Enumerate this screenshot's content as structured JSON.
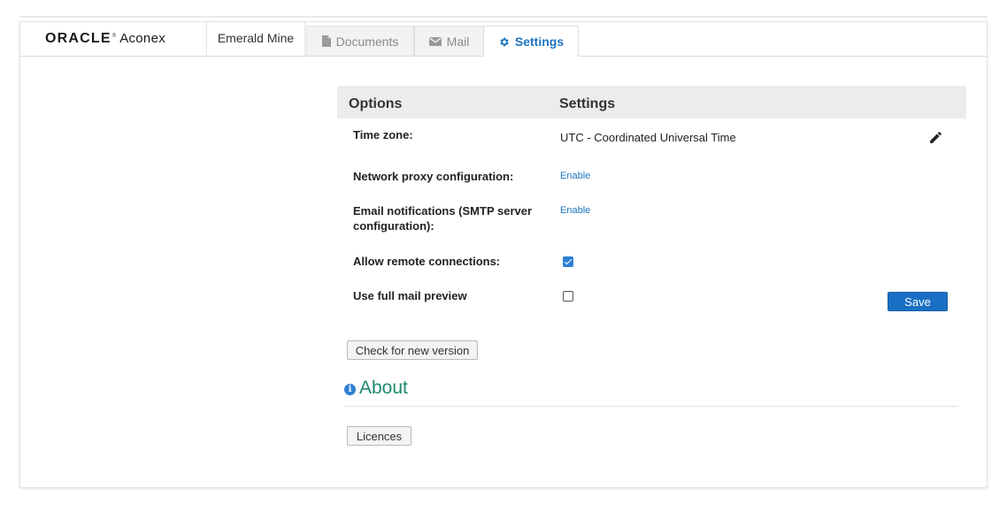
{
  "brand": {
    "oracle": "ORACLE",
    "reg": "®",
    "product": "Aconex"
  },
  "project": {
    "name": "Emerald Mine"
  },
  "tabs": [
    {
      "label": "Documents",
      "icon": "document-icon",
      "active": false
    },
    {
      "label": "Mail",
      "icon": "envelope-icon",
      "active": false
    },
    {
      "label": "Settings",
      "icon": "gear-icon",
      "active": true
    }
  ],
  "panel": {
    "col_options": "Options",
    "col_settings": "Settings"
  },
  "rows": {
    "timezone": {
      "label": "Time zone:",
      "value": "UTC - Coordinated Universal Time",
      "icon": "pencil-icon"
    },
    "proxy": {
      "label": "Network proxy configuration:",
      "link": "Enable"
    },
    "smtp": {
      "label": "Email notifications (SMTP server configuration):",
      "link": "Enable"
    },
    "remote": {
      "label": "Allow remote connections:",
      "checked": true
    },
    "preview": {
      "label": "Use full mail preview",
      "checked": false
    }
  },
  "buttons": {
    "save": "Save",
    "check_version": "Check for new version",
    "licences": "Licences"
  },
  "about": {
    "title": "About",
    "icon": "info-icon"
  },
  "colors": {
    "accent": "#1e73be",
    "about": "#1f8a6d",
    "save_bg": "#1a6fc4"
  }
}
